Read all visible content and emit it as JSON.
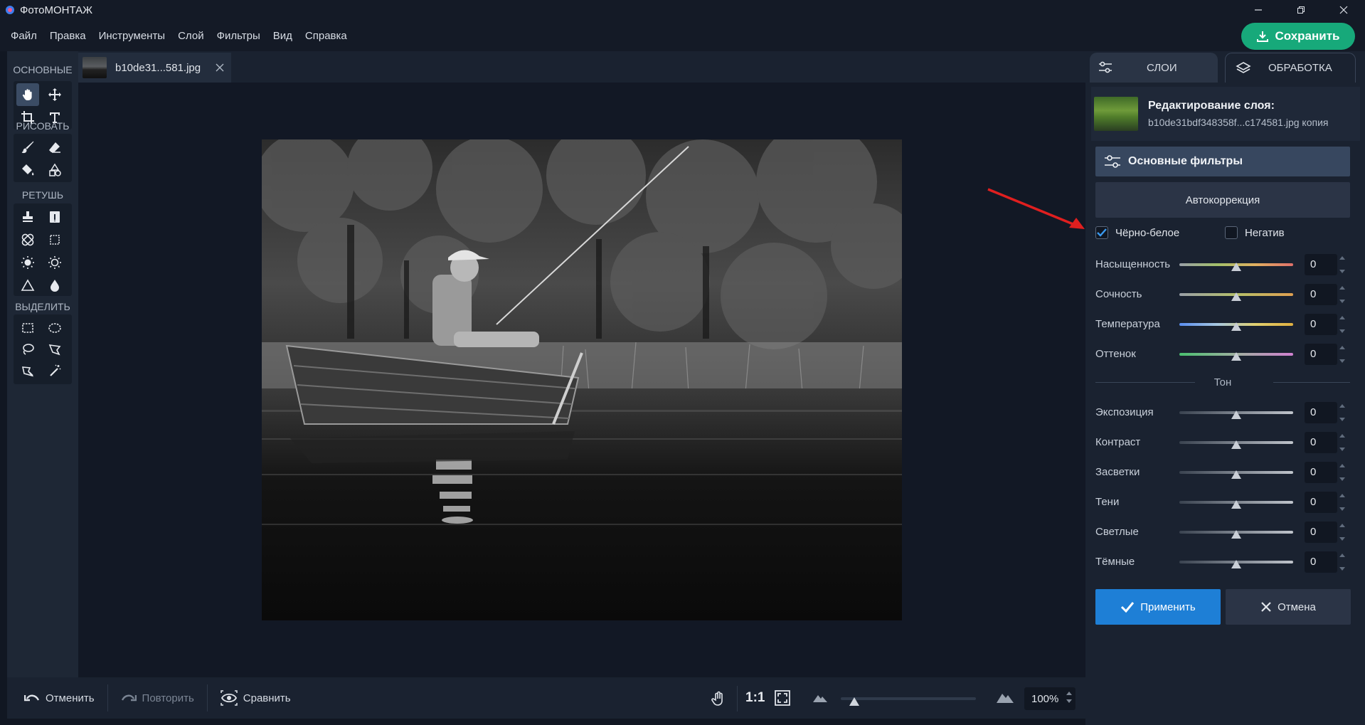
{
  "app": {
    "title": "ФотоМОНТАЖ"
  },
  "menu": [
    "Файл",
    "Правка",
    "Инструменты",
    "Слой",
    "Фильтры",
    "Вид",
    "Справка"
  ],
  "save_button": "Сохранить",
  "tool_sections": {
    "basic": "ОСНОВНЫЕ",
    "draw": "РИСОВАТЬ",
    "retouch": "РЕТУШЬ",
    "select": "ВЫДЕЛИТЬ"
  },
  "document_tab": {
    "name": "b10de31...581.jpg"
  },
  "right_tabs": {
    "layers": "СЛОИ",
    "processing": "ОБРАБОТКА"
  },
  "layer_edit": {
    "title": "Редактирование слоя:",
    "file": "b10de31bdf348358f...c174581.jpg копия"
  },
  "filters": {
    "section_label": "Основные фильтры",
    "autocorrect_label": "Автокоррекция",
    "bw_label": "Чёрно-белое",
    "bw_checked": true,
    "negative_label": "Негатив",
    "negative_checked": false
  },
  "color_adjustments": [
    {
      "label": "Насыщенность",
      "value": "0"
    },
    {
      "label": "Сочность",
      "value": "0"
    },
    {
      "label": "Температура",
      "value": "0"
    },
    {
      "label": "Оттенок",
      "value": "0"
    }
  ],
  "tone_label": "Тон",
  "tone_adjustments": [
    {
      "label": "Экспозиция",
      "value": "0"
    },
    {
      "label": "Контраст",
      "value": "0"
    },
    {
      "label": "Засветки",
      "value": "0"
    },
    {
      "label": "Тени",
      "value": "0"
    },
    {
      "label": "Светлые",
      "value": "0"
    },
    {
      "label": "Тёмные",
      "value": "0"
    }
  ],
  "apply_button": "Применить",
  "cancel_button": "Отмена",
  "bottom": {
    "undo": "Отменить",
    "redo": "Повторить",
    "compare": "Сравнить",
    "one_to_one": "1:1",
    "zoom": "100%",
    "zoom_level": 0.1
  },
  "colors": {
    "accent_green": "#17a97a",
    "accent_blue": "#1e7fd6",
    "annotation_red": "#e01f1f"
  }
}
